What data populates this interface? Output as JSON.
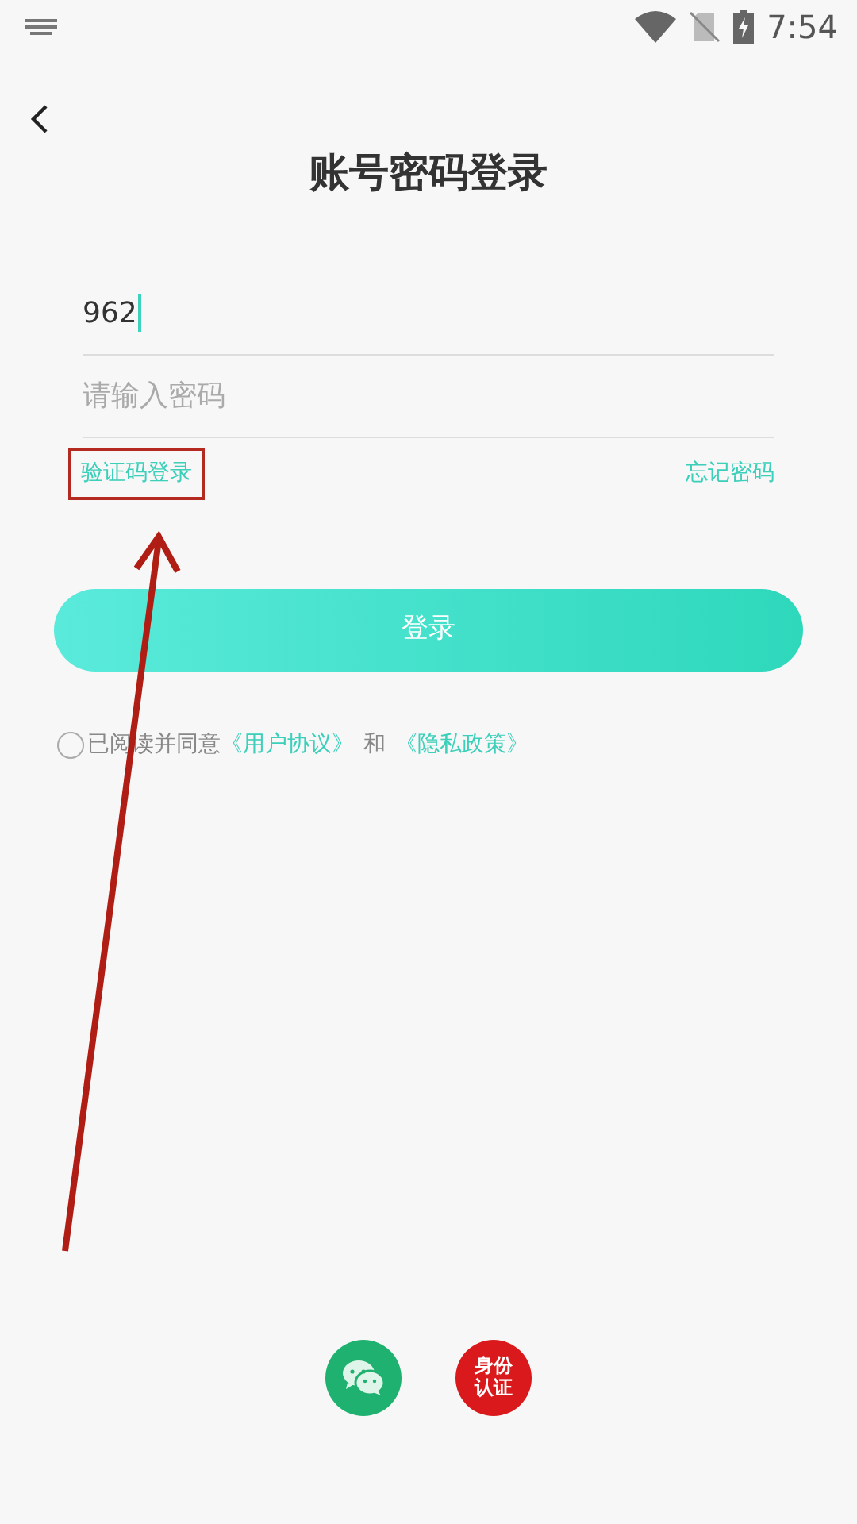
{
  "status_bar": {
    "time": "7:54"
  },
  "title": "账号密码登录",
  "phone_field": {
    "value": "962"
  },
  "password_field": {
    "placeholder": "请输入密码"
  },
  "links": [
    {
      "label": "验证码登录",
      "highlighted": true
    },
    {
      "label": "忘记密码",
      "highlighted": false
    }
  ],
  "login_button": {
    "label": "登录"
  },
  "agreement": {
    "checked": false,
    "parts": [
      {
        "text": "已阅读并同意",
        "kind": "plain"
      },
      {
        "text": "《用户协议》",
        "kind": "link"
      },
      {
        "text": "和",
        "kind": "plain"
      },
      {
        "text": "《隐私政策》",
        "kind": "link"
      }
    ]
  },
  "social_logins": [
    {
      "kind": "wechat"
    },
    {
      "kind": "id",
      "label": "身份认证"
    }
  ],
  "annotation_arrow": true
}
